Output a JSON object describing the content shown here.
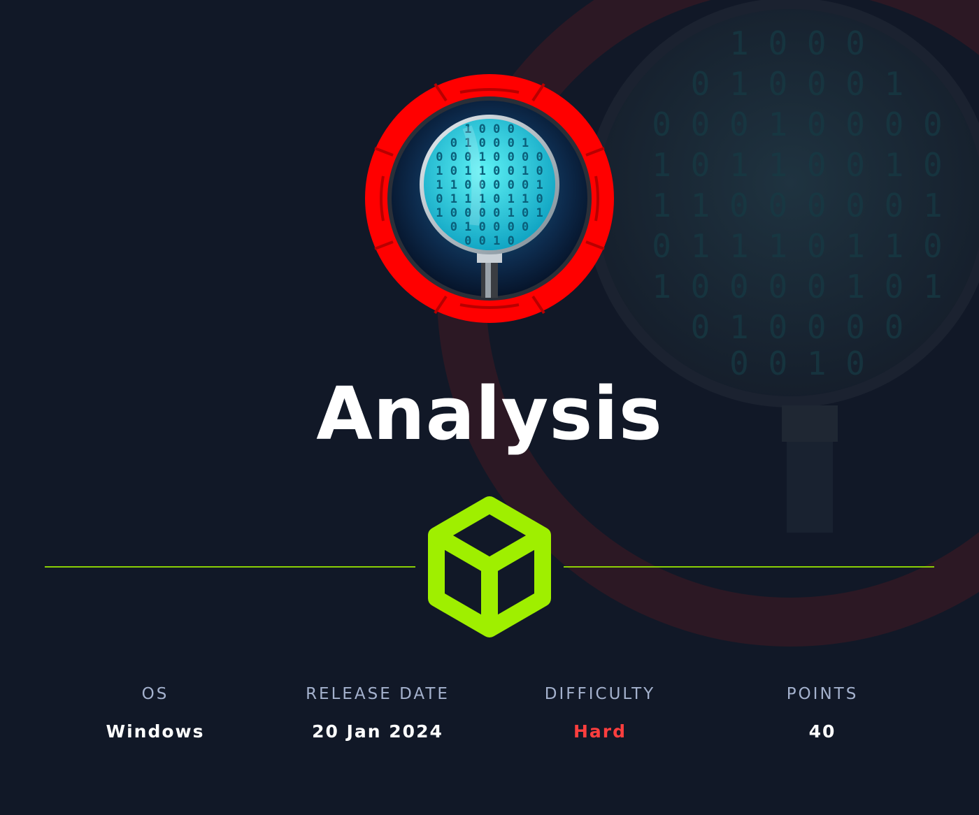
{
  "machine": {
    "name": "Analysis",
    "logo_icon": "magnifying-glass-binary-icon"
  },
  "divider_icon": "cube-icon",
  "colors": {
    "background": "#111827",
    "accent": "#9fef00",
    "logo_ring": "#ff0000",
    "difficulty": "#ff3e3e",
    "label": "#a4b1cd"
  },
  "stats": [
    {
      "label": "OS",
      "value": "Windows"
    },
    {
      "label": "RELEASE DATE",
      "value": "20 Jan 2024"
    },
    {
      "label": "DIFFICULTY",
      "value": "Hard"
    },
    {
      "label": "POINTS",
      "value": "40"
    }
  ]
}
